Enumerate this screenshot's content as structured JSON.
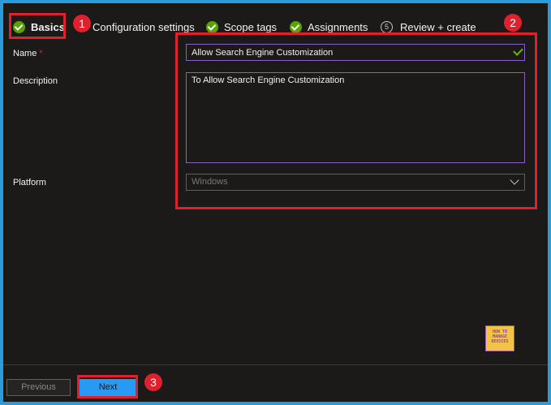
{
  "wizard": {
    "steps": [
      {
        "label": "Basics",
        "status": "complete"
      },
      {
        "label": "Configuration settings",
        "status": "complete"
      },
      {
        "label": "Scope tags",
        "status": "complete"
      },
      {
        "label": "Assignments",
        "status": "complete"
      },
      {
        "label": "Review + create",
        "number": "5"
      }
    ]
  },
  "form": {
    "name_label": "Name",
    "required_mark": "*",
    "name_value": "Allow Search Engine Customization",
    "description_label": "Description",
    "description_value": "To Allow Search Engine Customization",
    "platform_label": "Platform",
    "platform_value": "Windows"
  },
  "footer": {
    "previous_label": "Previous",
    "next_label": "Next"
  },
  "annotations": {
    "callout_1": "1",
    "callout_2": "2",
    "callout_3": "3",
    "highlight_color": "#e0202d"
  },
  "watermark": {
    "line1": "HOW TO",
    "line2": "MANAGE",
    "line3": "DEVICES"
  },
  "colors": {
    "border": "#2c9bdc",
    "background": "#1b1a19",
    "success": "#57a300",
    "primary_button": "#2899f5",
    "focus_border": "#8a60c8"
  }
}
